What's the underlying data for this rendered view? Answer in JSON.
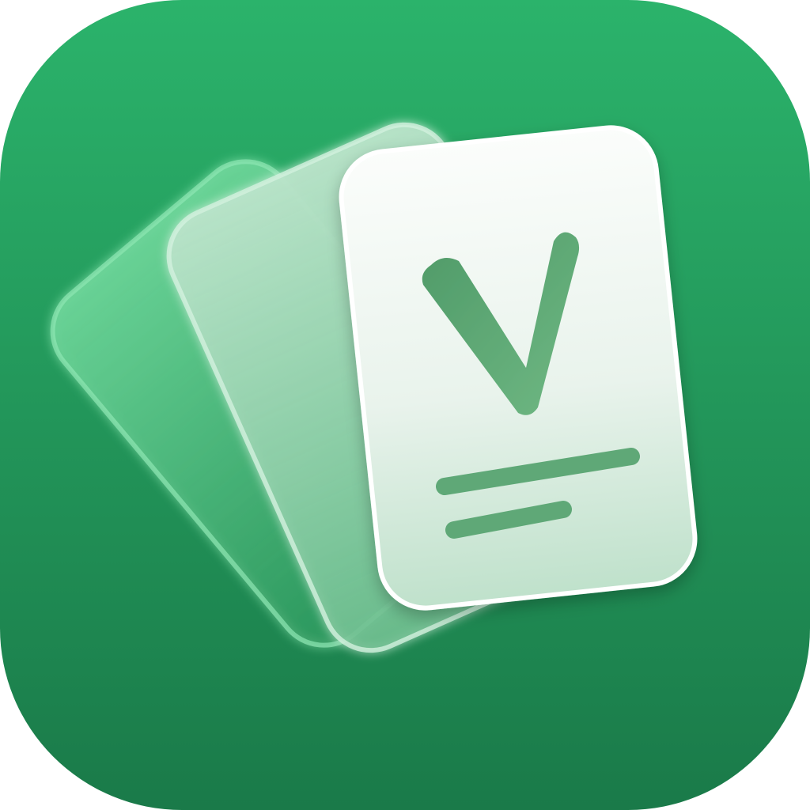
{
  "icon": {
    "kind": "app-icon",
    "glyph": "V",
    "subject": "stack-of-three-flashcards",
    "colors": {
      "background_top": "#2bb36b",
      "background_bottom": "#1a7a49",
      "card_back": "#5fd08f",
      "card_middle": "#a8dcbc",
      "card_front": "#f4f8f5",
      "glyph": "#5fa877",
      "lines": "#5fa877"
    }
  }
}
